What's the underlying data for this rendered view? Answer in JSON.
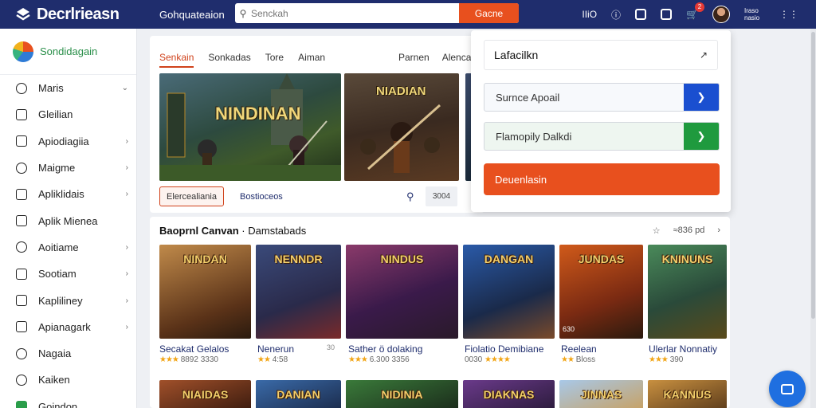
{
  "header": {
    "logo": "Decrlrieasn",
    "nav_link": "Gohquateaion",
    "search_placeholder": "Senckah",
    "search_button": "Gacne",
    "icons": [
      "user-icon",
      "info-icon",
      "image-icon",
      "chat-icon",
      "cart-icon",
      "grid-icon"
    ],
    "ico_label": "IIiO",
    "notification_count": "2",
    "user_name": "Iraso nasio"
  },
  "sidebar": {
    "brand": "Sondidagain",
    "items": [
      {
        "label": "Maris",
        "icon": "user-icon",
        "chevron": true
      },
      {
        "label": "Gleilian",
        "icon": "folder-icon",
        "chevron": false
      },
      {
        "label": "Apiodiagiia",
        "icon": "document-icon",
        "chevron": true
      },
      {
        "label": "Maigme",
        "icon": "search-icon",
        "chevron": true
      },
      {
        "label": "Apliklidais",
        "icon": "edit-icon",
        "chevron": true
      },
      {
        "label": "Aplik Mienea",
        "icon": "page-icon",
        "chevron": false
      },
      {
        "label": "Aoitiame",
        "icon": "settings-icon",
        "chevron": true
      },
      {
        "label": "Sootiam",
        "icon": "calendar-icon",
        "chevron": true
      },
      {
        "label": "Kapliliney",
        "icon": "tag-icon",
        "chevron": true
      },
      {
        "label": "Apianagark",
        "icon": "list-icon",
        "chevron": true
      },
      {
        "label": "Nagaia",
        "icon": "circle-icon",
        "chevron": false
      },
      {
        "label": "Kaiken",
        "icon": "clock-icon",
        "chevron": false
      },
      {
        "label": "Goindon",
        "icon": "home-icon",
        "chevron": false
      }
    ]
  },
  "featured": {
    "tabs": [
      "Senkain",
      "Sonkadas",
      "Tore",
      "Aiman"
    ],
    "tabs_right": [
      "Parnen",
      "Alenca"
    ],
    "banners": [
      "NINDINAN",
      "NIADIAN"
    ],
    "chip_primary": "Elercealiania",
    "chip_secondary": "Bostioceos",
    "counter": "3004"
  },
  "dropdown": {
    "title": "Lafacilkn",
    "row_blue": "Surnce Apoail",
    "row_green": "Flamopily Dalkdi",
    "cta": "Deuenlasin"
  },
  "section": {
    "title": "Baoprnl Canvan",
    "subtitle": "Damstabads",
    "right_label": "≈836 pd",
    "cards": [
      {
        "art": "NINDAN",
        "name": "Secakat Gelalos",
        "stars": "★★★",
        "meta": "8892 3330"
      },
      {
        "art": "NENNDR",
        "name": "Nenerun",
        "stars": "★★",
        "meta": "4:58",
        "count": "30"
      },
      {
        "art": "NINDUS",
        "name": "Sather ö dolaking",
        "stars": "★★★",
        "meta": "6.300 3356"
      },
      {
        "art": "DANGAN",
        "name": "Fiolatio Demibiane",
        "stars": "★★★★",
        "meta": "0030"
      },
      {
        "art": "JUNDAS",
        "name": "Reelean",
        "stars": "★★",
        "meta": "Bloss",
        "count": "630"
      },
      {
        "art": "KNINUNS",
        "name": "Ulerlar Nonnatiy",
        "stars": "★★★",
        "meta": "390"
      }
    ],
    "row2": [
      "NIAIDAS",
      "DANIAN",
      "NIDINIA",
      "DIAKNAS",
      "JINNAS",
      "KANNUS"
    ]
  },
  "colors": {
    "header": "#1f2d6d",
    "accent": "#e8501e",
    "blue": "#1a4fd0",
    "green": "#1f9a3e"
  }
}
